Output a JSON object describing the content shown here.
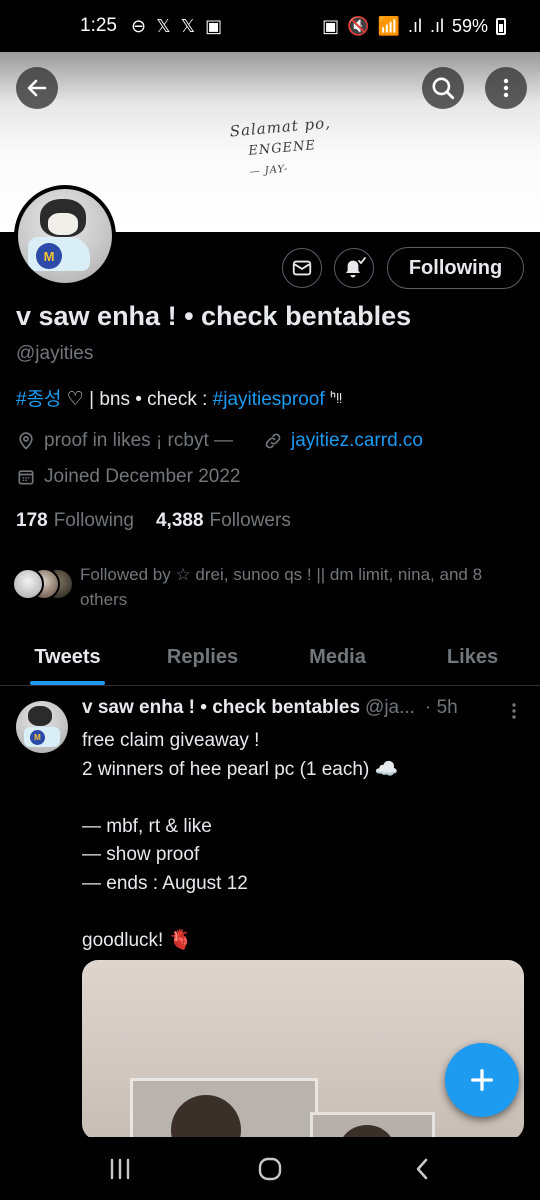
{
  "status_bar": {
    "time": "1:25",
    "left_glyphs": [
      "⊖",
      "𝕏",
      "𝕏",
      "▣"
    ],
    "right_glyphs": [
      "▣",
      "🔇",
      "📶",
      ".ıl",
      ".ıl"
    ],
    "battery": "59%"
  },
  "banner": {
    "line1": "Salamat po,",
    "line2": "ENGENE",
    "line3": "— JAY-"
  },
  "header_icons": {
    "back": "arrow-left-icon",
    "search": "search-icon",
    "more": "more-vertical-icon"
  },
  "profile": {
    "name": "v saw enha ! • check bentables",
    "handle": "@jayities",
    "bio": {
      "hashtag1": "#종성",
      "text1": " ♡ | bns • check : ",
      "hashtag2": "#jayitiesproof",
      "text2": " ᑋᵎᵎ"
    },
    "location": "proof in likes ¡ rcbyt —",
    "website": "jayitiez.carrd.co",
    "joined": "Joined December 2022",
    "following_count": "178",
    "following_label": "Following",
    "followers_count": "4,388",
    "followers_label": "Followers",
    "followed_by": "Followed by ☆ drei, sunoo qs ! || dm limit, nina, and 8 others"
  },
  "actions": {
    "message": "envelope-icon",
    "notify": "bell-check-icon",
    "follow_button": "Following"
  },
  "tabs": [
    {
      "label": "Tweets",
      "active": true
    },
    {
      "label": "Replies",
      "active": false
    },
    {
      "label": "Media",
      "active": false
    },
    {
      "label": "Likes",
      "active": false
    }
  ],
  "tweet": {
    "author_name": "v saw enha ! • check bentables",
    "author_handle": "@ja...",
    "time": "· 5h",
    "lines": [
      "free claim giveaway !",
      "2 winners of hee pearl pc (1 each) ☁️",
      "",
      "— mbf, rt & like",
      "— show proof",
      "— ends : August 12",
      "",
      "goodluck! 🫀"
    ]
  },
  "avatar_logo": "M",
  "colors": {
    "background": "#000000",
    "text_primary": "#e7e9ea",
    "text_secondary": "#71767b",
    "accent": "#1d9bf0",
    "border": "#2f3336"
  }
}
